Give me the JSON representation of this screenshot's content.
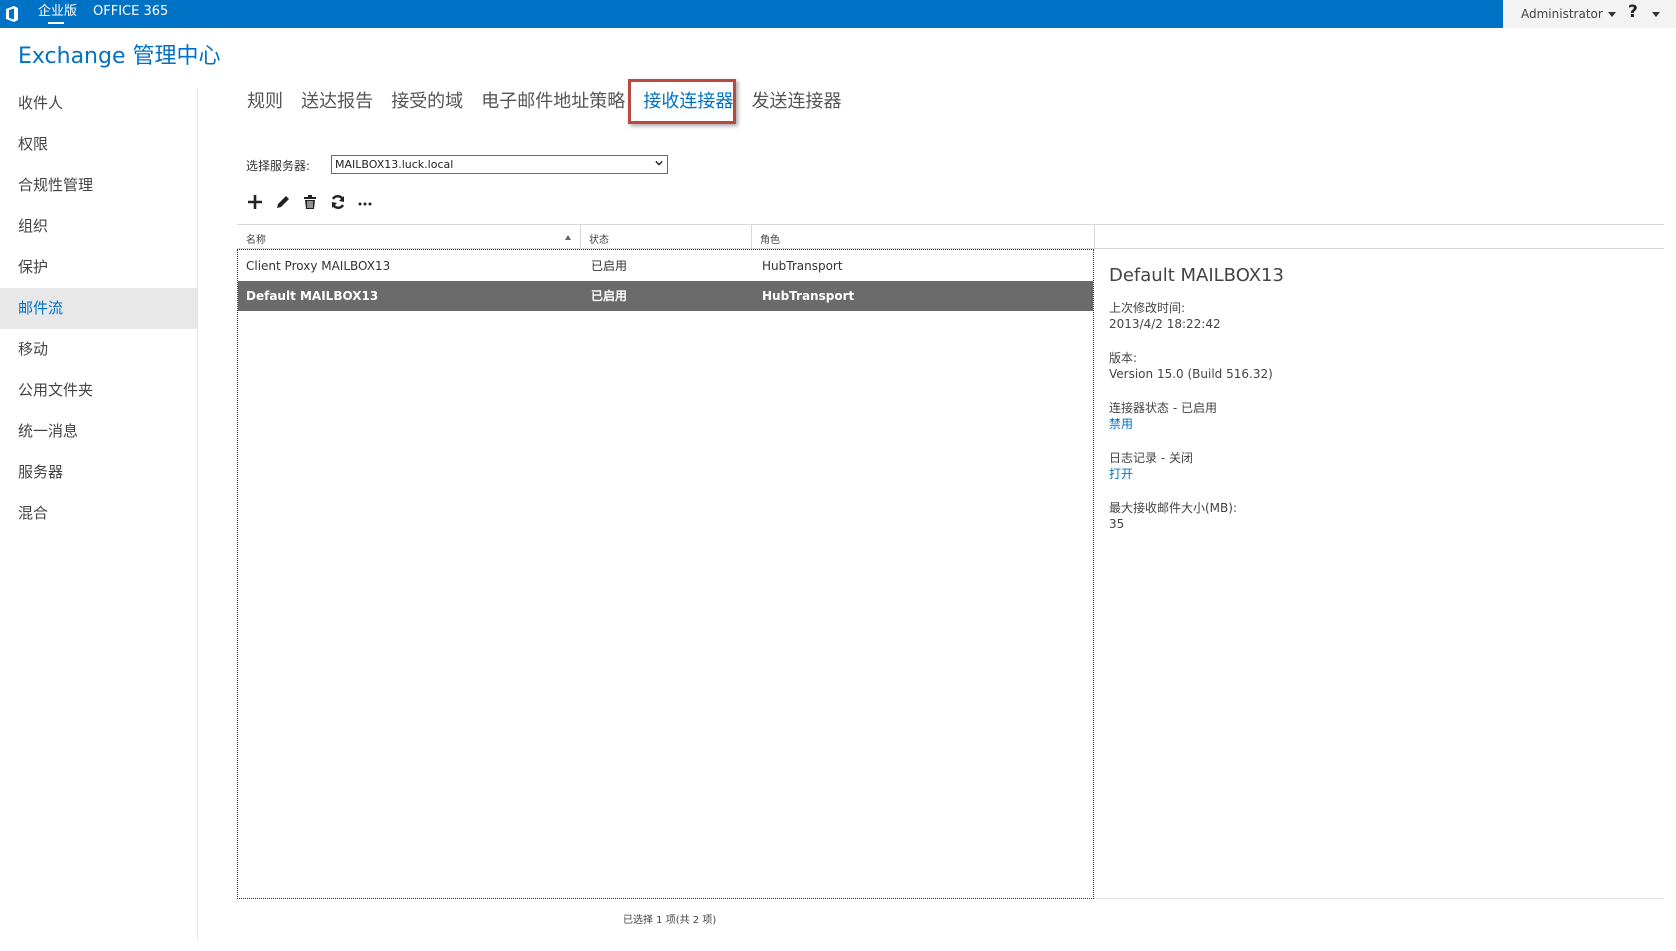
{
  "topbar": {
    "edition_label": "企业版",
    "office_label": "OFFICE 365",
    "user_name": "Administrator",
    "help_label": "?"
  },
  "app": {
    "title": "Exchange 管理中心"
  },
  "sidebar": {
    "items": [
      {
        "label": "收件人"
      },
      {
        "label": "权限"
      },
      {
        "label": "合规性管理"
      },
      {
        "label": "组织"
      },
      {
        "label": "保护"
      },
      {
        "label": "邮件流",
        "active": true
      },
      {
        "label": "移动"
      },
      {
        "label": "公用文件夹"
      },
      {
        "label": "统一消息"
      },
      {
        "label": "服务器"
      },
      {
        "label": "混合"
      }
    ]
  },
  "tabs": [
    {
      "label": "规则"
    },
    {
      "label": "送达报告"
    },
    {
      "label": "接受的域"
    },
    {
      "label": "电子邮件地址策略"
    },
    {
      "label": "接收连接器",
      "active": true
    },
    {
      "label": "发送连接器"
    }
  ],
  "server_picker": {
    "label": "选择服务器:",
    "value": "MAILBOX13.luck.local"
  },
  "toolbar": {
    "icons": [
      "add-icon",
      "edit-icon",
      "delete-icon",
      "refresh-icon",
      "more-icon"
    ]
  },
  "grid": {
    "columns": [
      "名称",
      "状态",
      "角色"
    ],
    "rows": [
      {
        "name": "Client Proxy MAILBOX13",
        "status": "已启用",
        "role": "HubTransport",
        "selected": false
      },
      {
        "name": "Default MAILBOX13",
        "status": "已启用",
        "role": "HubTransport",
        "selected": true
      }
    ]
  },
  "details": {
    "title": "Default MAILBOX13",
    "modified_label": "上次修改时间:",
    "modified_value": "2013/4/2 18:22:42",
    "version_label": "版本:",
    "version_value": "Version 15.0 (Build 516.32)",
    "connector_status": "连接器状态 - 已启用",
    "connector_action": "禁用",
    "logging_status": "日志记录 - 关闭",
    "logging_action": "打开",
    "max_size_label": "最大接收邮件大小(MB):",
    "max_size_value": "35"
  },
  "status_bar": {
    "text": "已选择 1 项(共 2 项)"
  },
  "colors": {
    "brand_blue": "#0072c6",
    "selected_row": "#6b6b6b",
    "highlight_box": "#b94a3e"
  }
}
